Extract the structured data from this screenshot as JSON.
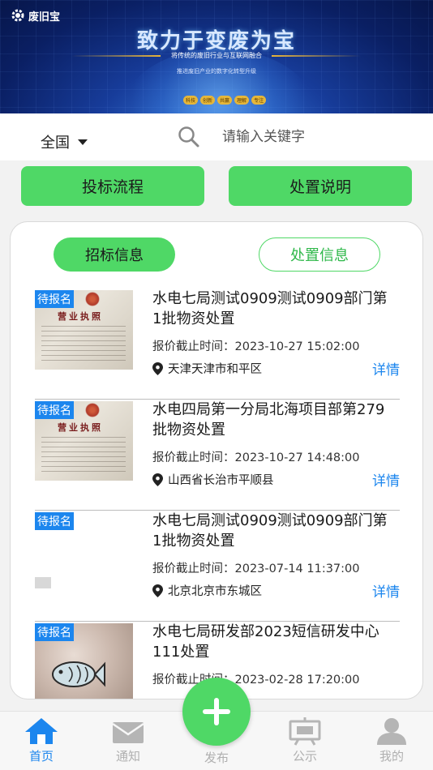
{
  "banner": {
    "logo": "废旧宝",
    "title": "致力于变废为宝",
    "subtitle": "将传统的废旧行业与互联网融合",
    "subtitle2": "推进废旧产业的数字化转型升级",
    "tags": [
      "科技",
      "创新",
      "共赢",
      "理解",
      "专注"
    ]
  },
  "search": {
    "region": "全国",
    "placeholder": "请输入关键字"
  },
  "actions": {
    "bid_process": "投标流程",
    "disposal_desc": "处置说明"
  },
  "segments": {
    "active": "招标信息",
    "inactive": "处置信息"
  },
  "items": [
    {
      "badge": "待报名",
      "title": "水电七局测试0909测试0909部门第1批物资处置",
      "deadline": "报价截止时间：2023-10-27 15:02:00",
      "location": "天津天津市和平区",
      "detail": "详情",
      "thumb": "business-license"
    },
    {
      "badge": "待报名",
      "title": "水电四局第一分局北海项目部第279批物资处置",
      "deadline": "报价截止时间：2023-10-27 14:48:00",
      "location": "山西省长治市平顺县",
      "detail": "详情",
      "thumb": "business-license"
    },
    {
      "badge": "待报名",
      "title": "水电七局测试0909测试0909部门第1批物资处置",
      "deadline": "报价截止时间：2023-07-14 11:37:00",
      "location": "北京北京市东城区",
      "detail": "详情",
      "thumb": "blank"
    },
    {
      "badge": "待报名",
      "title": "水电七局研发部2023短信研发中心111处置",
      "deadline": "报价截止时间：2023-02-28 17:20:00",
      "thumb": "photo"
    }
  ],
  "license_text": "营业执照",
  "nav": {
    "home": "首页",
    "notice": "通知",
    "publish": "发布",
    "announcement": "公示",
    "mine": "我的"
  },
  "colors": {
    "accent_green": "#4fd866",
    "accent_blue": "#1c86ee",
    "inactive_gray": "#b0b0b0"
  }
}
